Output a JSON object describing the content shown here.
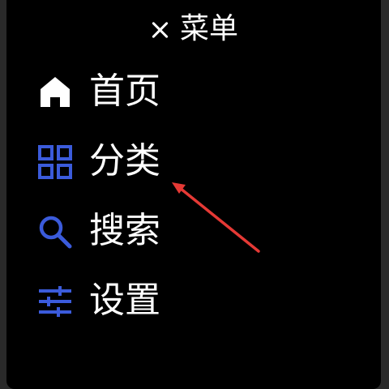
{
  "menu": {
    "title": "菜单",
    "close_icon": "close-icon",
    "items": [
      {
        "label": "首页",
        "icon": "home-icon",
        "icon_color": "#ffffff"
      },
      {
        "label": "分类",
        "icon": "grid-icon",
        "icon_color": "#3b5bdb"
      },
      {
        "label": "搜索",
        "icon": "search-icon",
        "icon_color": "#3b5bdb"
      },
      {
        "label": "设置",
        "icon": "sliders-icon",
        "icon_color": "#3b5bdb"
      }
    ]
  },
  "annotation": {
    "arrow_color": "#e53935"
  },
  "colors": {
    "background": "#000000",
    "text": "#ffffff",
    "accent": "#3b5bdb",
    "frame": "#2a2a2a"
  }
}
